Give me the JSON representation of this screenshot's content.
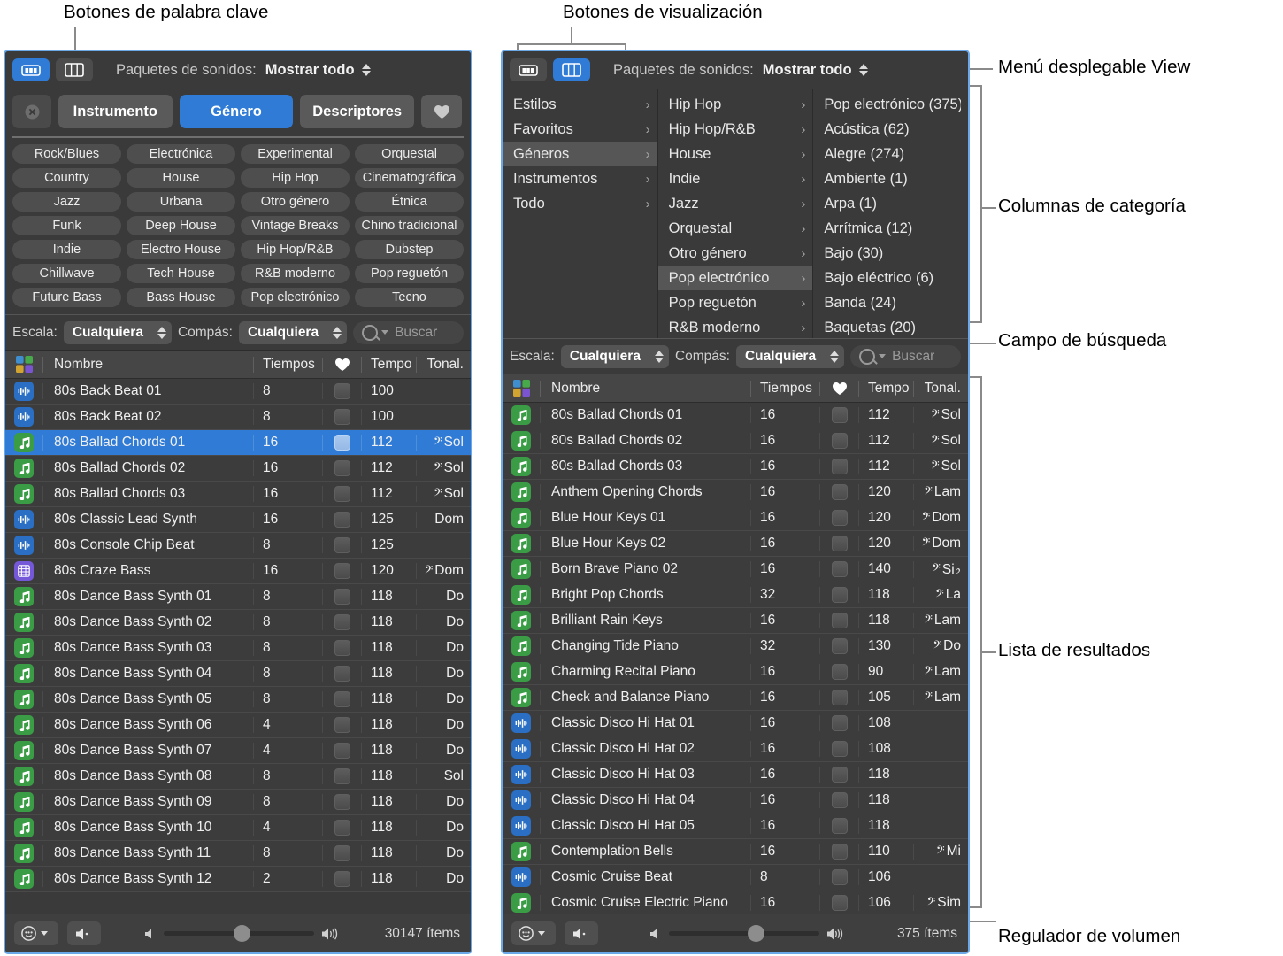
{
  "annotations": [
    {
      "id": "keyword-buttons",
      "text": "Botones de palabra clave"
    },
    {
      "id": "view-buttons",
      "text": "Botones de visualización"
    },
    {
      "id": "view-popup-menu",
      "text": "Menú desplegable View"
    },
    {
      "id": "category-columns",
      "text": "Columnas de categoría"
    },
    {
      "id": "search-field",
      "text": "Campo de búsqueda"
    },
    {
      "id": "results-list",
      "text": "Lista de resultados"
    },
    {
      "id": "volume-slider",
      "text": "Regulador de volumen"
    }
  ],
  "left_panel": {
    "toolbar": {
      "sound_packs_label": "Paquetes de sonidos:",
      "sound_packs_value": "Mostrar todo",
      "button_view_icon": "button-view-icon",
      "column_view_icon": "column-view-icon",
      "active_view": "button"
    },
    "category_bar": {
      "clear_label": "clear-icon",
      "buttons": [
        {
          "label": "Instrumento",
          "selected": false
        },
        {
          "label": "Género",
          "selected": true
        },
        {
          "label": "Descriptores",
          "selected": false
        }
      ],
      "favorites_icon": "heart-icon"
    },
    "keywords": [
      "Rock/Blues",
      "Electrónica",
      "Experimental",
      "Orquestal",
      "Country",
      "House",
      "Hip Hop",
      "Cinematográfica",
      "Jazz",
      "Urbana",
      "Otro género",
      "Étnica",
      "Funk",
      "Deep House",
      "Vintage Breaks",
      "Chino tradicional",
      "Indie",
      "Electro House",
      "Hip Hop/R&B",
      "Dubstep",
      "Chillwave",
      "Tech House",
      "R&B moderno",
      "Pop reguetón",
      "Future Bass",
      "Bass House",
      "Pop electrónico",
      "Tecno"
    ],
    "filters": {
      "scale_label": "Escala:",
      "scale_value": "Cualquiera",
      "meter_label": "Compás:",
      "meter_value": "Cualquiera",
      "search_placeholder": "Buscar",
      "search_value": ""
    },
    "table": {
      "headers": {
        "icon": "color-grid-icon",
        "name": "Nombre",
        "beats": "Tiempos",
        "favorite": "heart-icon",
        "tempo": "Tempo",
        "key": "Tonal."
      },
      "rows": [
        {
          "icon": "audio",
          "name": "80s Back Beat 01",
          "beats": "8",
          "tempo": "100",
          "key": "",
          "clef": false,
          "selected": false
        },
        {
          "icon": "audio",
          "name": "80s Back Beat 02",
          "beats": "8",
          "tempo": "100",
          "key": "",
          "clef": false,
          "selected": false
        },
        {
          "icon": "midi",
          "name": "80s Ballad Chords 01",
          "beats": "16",
          "tempo": "112",
          "key": "Sol",
          "clef": true,
          "selected": true
        },
        {
          "icon": "midi",
          "name": "80s Ballad Chords 02",
          "beats": "16",
          "tempo": "112",
          "key": "Sol",
          "clef": true,
          "selected": false
        },
        {
          "icon": "midi",
          "name": "80s Ballad Chords 03",
          "beats": "16",
          "tempo": "112",
          "key": "Sol",
          "clef": true,
          "selected": false
        },
        {
          "icon": "audio",
          "name": "80s Classic Lead Synth",
          "beats": "16",
          "tempo": "125",
          "key": "Dom",
          "clef": false,
          "selected": false
        },
        {
          "icon": "audio",
          "name": "80s Console Chip Beat",
          "beats": "8",
          "tempo": "125",
          "key": "",
          "clef": false,
          "selected": false
        },
        {
          "icon": "pattern",
          "name": "80s Craze Bass",
          "beats": "16",
          "tempo": "120",
          "key": "Dom",
          "clef": true,
          "selected": false
        },
        {
          "icon": "midi",
          "name": "80s Dance Bass Synth 01",
          "beats": "8",
          "tempo": "118",
          "key": "Do",
          "clef": false,
          "selected": false
        },
        {
          "icon": "midi",
          "name": "80s Dance Bass Synth 02",
          "beats": "8",
          "tempo": "118",
          "key": "Do",
          "clef": false,
          "selected": false
        },
        {
          "icon": "midi",
          "name": "80s Dance Bass Synth 03",
          "beats": "8",
          "tempo": "118",
          "key": "Do",
          "clef": false,
          "selected": false
        },
        {
          "icon": "midi",
          "name": "80s Dance Bass Synth 04",
          "beats": "8",
          "tempo": "118",
          "key": "Do",
          "clef": false,
          "selected": false
        },
        {
          "icon": "midi",
          "name": "80s Dance Bass Synth 05",
          "beats": "8",
          "tempo": "118",
          "key": "Do",
          "clef": false,
          "selected": false
        },
        {
          "icon": "midi",
          "name": "80s Dance Bass Synth 06",
          "beats": "4",
          "tempo": "118",
          "key": "Do",
          "clef": false,
          "selected": false
        },
        {
          "icon": "midi",
          "name": "80s Dance Bass Synth 07",
          "beats": "4",
          "tempo": "118",
          "key": "Do",
          "clef": false,
          "selected": false
        },
        {
          "icon": "midi",
          "name": "80s Dance Bass Synth 08",
          "beats": "8",
          "tempo": "118",
          "key": "Sol",
          "clef": false,
          "selected": false
        },
        {
          "icon": "midi",
          "name": "80s Dance Bass Synth 09",
          "beats": "8",
          "tempo": "118",
          "key": "Do",
          "clef": false,
          "selected": false
        },
        {
          "icon": "midi",
          "name": "80s Dance Bass Synth 10",
          "beats": "4",
          "tempo": "118",
          "key": "Do",
          "clef": false,
          "selected": false
        },
        {
          "icon": "midi",
          "name": "80s Dance Bass Synth 11",
          "beats": "8",
          "tempo": "118",
          "key": "Do",
          "clef": false,
          "selected": false
        },
        {
          "icon": "midi",
          "name": "80s Dance Bass Synth 12",
          "beats": "2",
          "tempo": "118",
          "key": "Do",
          "clef": false,
          "selected": false
        }
      ]
    },
    "bottom_bar": {
      "options_icon": "circle-menu-icon",
      "mute_icon": "speaker-low-icon",
      "volume_low_icon": "speaker-min-icon",
      "volume_high_icon": "speaker-max-icon",
      "volume_percent": 52,
      "item_count": "30147 ítems"
    }
  },
  "right_panel": {
    "toolbar": {
      "sound_packs_label": "Paquetes de sonidos:",
      "sound_packs_value": "Mostrar todo",
      "button_view_icon": "button-view-icon",
      "column_view_icon": "column-view-icon",
      "active_view": "column"
    },
    "columns": [
      {
        "items": [
          {
            "label": "Estilos",
            "chevron": true,
            "selected": false
          },
          {
            "label": "Favoritos",
            "chevron": true,
            "selected": false
          },
          {
            "label": "Géneros",
            "chevron": true,
            "selected": true
          },
          {
            "label": "Instrumentos",
            "chevron": true,
            "selected": false
          },
          {
            "label": "Todo",
            "chevron": true,
            "selected": false
          }
        ]
      },
      {
        "items": [
          {
            "label": "Hip Hop",
            "chevron": true,
            "selected": false
          },
          {
            "label": "Hip Hop/R&B",
            "chevron": true,
            "selected": false
          },
          {
            "label": "House",
            "chevron": true,
            "selected": false
          },
          {
            "label": "Indie",
            "chevron": true,
            "selected": false
          },
          {
            "label": "Jazz",
            "chevron": true,
            "selected": false
          },
          {
            "label": "Orquestal",
            "chevron": true,
            "selected": false
          },
          {
            "label": "Otro género",
            "chevron": true,
            "selected": false
          },
          {
            "label": "Pop electrónico",
            "chevron": true,
            "selected": true
          },
          {
            "label": "Pop reguetón",
            "chevron": true,
            "selected": false
          },
          {
            "label": "R&B moderno",
            "chevron": true,
            "selected": false
          }
        ]
      },
      {
        "items": [
          {
            "label": "Pop electrónico (375)",
            "chevron": false,
            "selected": false
          },
          {
            "label": "Acústica (62)",
            "chevron": false,
            "selected": false
          },
          {
            "label": "Alegre (274)",
            "chevron": false,
            "selected": false
          },
          {
            "label": "Ambiente (1)",
            "chevron": false,
            "selected": false
          },
          {
            "label": "Arpa (1)",
            "chevron": false,
            "selected": false
          },
          {
            "label": "Arrítmica (12)",
            "chevron": false,
            "selected": false
          },
          {
            "label": "Bajo (30)",
            "chevron": false,
            "selected": false
          },
          {
            "label": "Bajo eléctrico (6)",
            "chevron": false,
            "selected": false
          },
          {
            "label": "Banda (24)",
            "chevron": false,
            "selected": false
          },
          {
            "label": "Baquetas (20)",
            "chevron": false,
            "selected": false
          }
        ]
      }
    ],
    "filters": {
      "scale_label": "Escala:",
      "scale_value": "Cualquiera",
      "meter_label": "Compás:",
      "meter_value": "Cualquiera",
      "search_placeholder": "Buscar",
      "search_value": ""
    },
    "table": {
      "headers": {
        "icon": "color-grid-icon",
        "name": "Nombre",
        "beats": "Tiempos",
        "favorite": "heart-icon",
        "tempo": "Tempo",
        "key": "Tonal."
      },
      "rows": [
        {
          "icon": "midi",
          "name": "80s Ballad Chords 01",
          "beats": "16",
          "tempo": "112",
          "key": "Sol",
          "clef": true,
          "selected": false
        },
        {
          "icon": "midi",
          "name": "80s Ballad Chords 02",
          "beats": "16",
          "tempo": "112",
          "key": "Sol",
          "clef": true,
          "selected": false
        },
        {
          "icon": "midi",
          "name": "80s Ballad Chords 03",
          "beats": "16",
          "tempo": "112",
          "key": "Sol",
          "clef": true,
          "selected": false
        },
        {
          "icon": "midi",
          "name": "Anthem Opening Chords",
          "beats": "16",
          "tempo": "120",
          "key": "Lam",
          "clef": true,
          "selected": false
        },
        {
          "icon": "midi",
          "name": "Blue Hour Keys 01",
          "beats": "16",
          "tempo": "120",
          "key": "Dom",
          "clef": true,
          "selected": false
        },
        {
          "icon": "midi",
          "name": "Blue Hour Keys 02",
          "beats": "16",
          "tempo": "120",
          "key": "Dom",
          "clef": true,
          "selected": false
        },
        {
          "icon": "midi",
          "name": "Born Brave Piano 02",
          "beats": "16",
          "tempo": "140",
          "key": "Si♭",
          "clef": true,
          "selected": false
        },
        {
          "icon": "midi",
          "name": "Bright Pop Chords",
          "beats": "32",
          "tempo": "118",
          "key": "La",
          "clef": true,
          "selected": false
        },
        {
          "icon": "midi",
          "name": "Brilliant Rain Keys",
          "beats": "16",
          "tempo": "118",
          "key": "Lam",
          "clef": true,
          "selected": false
        },
        {
          "icon": "midi",
          "name": "Changing Tide Piano",
          "beats": "32",
          "tempo": "130",
          "key": "Do",
          "clef": true,
          "selected": false
        },
        {
          "icon": "midi",
          "name": "Charming Recital Piano",
          "beats": "16",
          "tempo": "90",
          "key": "Lam",
          "clef": true,
          "selected": false
        },
        {
          "icon": "midi",
          "name": "Check and Balance Piano",
          "beats": "16",
          "tempo": "105",
          "key": "Lam",
          "clef": true,
          "selected": false
        },
        {
          "icon": "audio",
          "name": "Classic Disco Hi Hat 01",
          "beats": "16",
          "tempo": "108",
          "key": "",
          "clef": false,
          "selected": false
        },
        {
          "icon": "audio",
          "name": "Classic Disco Hi Hat 02",
          "beats": "16",
          "tempo": "108",
          "key": "",
          "clef": false,
          "selected": false
        },
        {
          "icon": "audio",
          "name": "Classic Disco Hi Hat 03",
          "beats": "16",
          "tempo": "118",
          "key": "",
          "clef": false,
          "selected": false
        },
        {
          "icon": "audio",
          "name": "Classic Disco Hi Hat 04",
          "beats": "16",
          "tempo": "118",
          "key": "",
          "clef": false,
          "selected": false
        },
        {
          "icon": "audio",
          "name": "Classic Disco Hi Hat 05",
          "beats": "16",
          "tempo": "118",
          "key": "",
          "clef": false,
          "selected": false
        },
        {
          "icon": "midi",
          "name": "Contemplation Bells",
          "beats": "16",
          "tempo": "110",
          "key": "Mi",
          "clef": true,
          "selected": false
        },
        {
          "icon": "audio",
          "name": "Cosmic Cruise Beat",
          "beats": "8",
          "tempo": "106",
          "key": "",
          "clef": false,
          "selected": false
        },
        {
          "icon": "midi",
          "name": "Cosmic Cruise Electric Piano",
          "beats": "16",
          "tempo": "106",
          "key": "Sim",
          "clef": true,
          "selected": false
        }
      ]
    },
    "bottom_bar": {
      "options_icon": "circle-menu-icon",
      "mute_icon": "speaker-low-icon",
      "volume_low_icon": "speaker-min-icon",
      "volume_high_icon": "speaker-max-icon",
      "volume_percent": 58,
      "item_count": "375 ítems"
    }
  },
  "colors": {
    "accent": "#2f7bd6",
    "window_border": "#6aa8e8",
    "panel_bg": "#3a3a3a",
    "row_bg": "#3c3c3c",
    "audio_icon": "#2a6fc4",
    "midi_icon": "#3b9c46",
    "pattern_icon": "#7558d8"
  }
}
